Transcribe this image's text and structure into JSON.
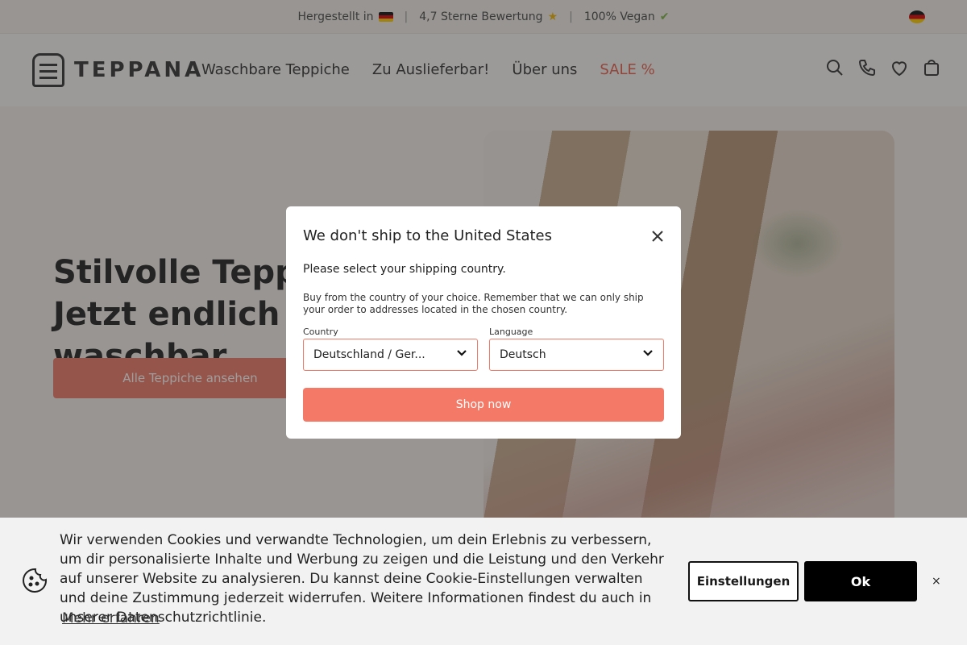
{
  "announcement": {
    "item1": "Hergestellt in",
    "item2": "4,7 Sterne Bewertung",
    "item3": "100% Vegan"
  },
  "header": {
    "logo_text": "TEPPANA",
    "nav": [
      "Waschbare Teppiche",
      "Zu Auslieferbar!",
      "Über uns",
      "SALE %"
    ]
  },
  "hero": {
    "title_line1": "Stilvolle Teppiche.",
    "title_line2": "Jetzt endlich waschbar.",
    "button": "Alle Teppiche ansehen"
  },
  "modal": {
    "title": "We don't ship to the United States",
    "subtitle": "Please select your shipping country.",
    "description": "Buy from the country of your choice. Remember that we can only ship your order to addresses located in the chosen country.",
    "country_label": "Country",
    "country_value": "Deutschland / Ger...",
    "language_label": "Language",
    "language_value": "Deutsch",
    "shop_button": "Shop now"
  },
  "cookie": {
    "text": "Wir verwenden Cookies und verwandte Technologien, um dein Erlebnis zu verbessern, um dir personalisierte Inhalte und Werbung zu zeigen und die Leistung und den Verkehr auf unserer Website zu analysieren. Du kannst deine Cookie-Einstellungen verwalten und deine Zustimmung jederzeit widerrufen. Weitere Informationen findest du auch in unserer Datenschutzrichtlinie.",
    "learn_more": "Mehr erfahren",
    "settings_button": "Einstellungen",
    "ok_button": "Ok",
    "close": "×"
  },
  "colors": {
    "accent": "#f47a67",
    "overlay": "rgba(40,40,40,0.45)",
    "cookie_bg": "#f2f2f2"
  },
  "icons": [
    "flag-de-icon",
    "star-icon",
    "leaf-icon",
    "search-icon",
    "phone-icon",
    "heart-icon",
    "bag-icon",
    "close-icon",
    "chevron-down-icon",
    "cookie-icon"
  ]
}
